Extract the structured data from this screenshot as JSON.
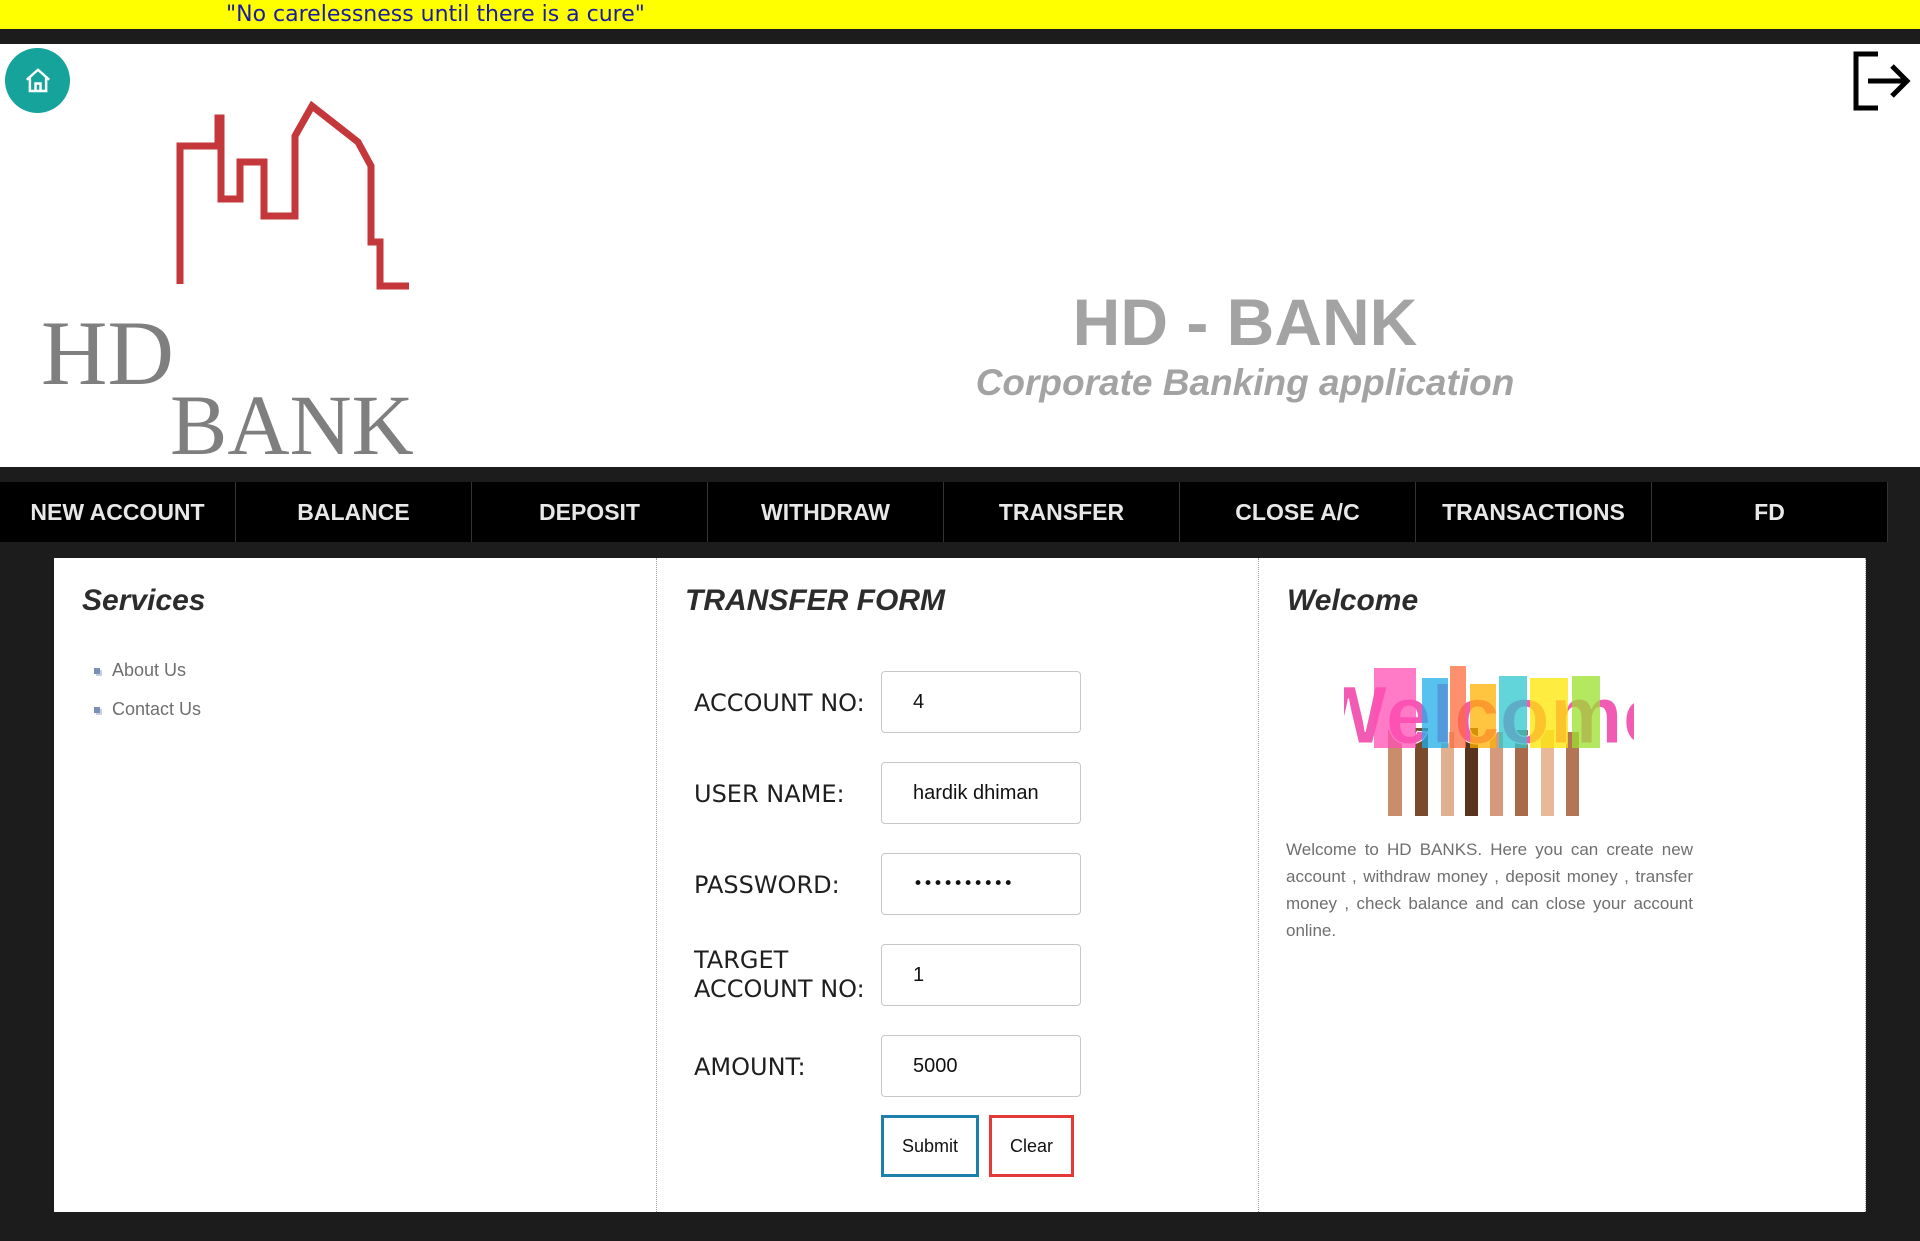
{
  "marquee": {
    "text": "\"No carelessness until there is a cure\""
  },
  "header": {
    "home_icon": "home-icon",
    "logout_icon": "logout-icon",
    "logo_text_line1": "HD",
    "logo_text_line2": "BANK",
    "title": "HD - BANK",
    "subtitle": "Corporate Banking application"
  },
  "nav": {
    "items": [
      {
        "label": "NEW ACCOUNT"
      },
      {
        "label": "BALANCE"
      },
      {
        "label": "DEPOSIT"
      },
      {
        "label": "WITHDRAW"
      },
      {
        "label": "TRANSFER"
      },
      {
        "label": "CLOSE A/C"
      },
      {
        "label": "TRANSACTIONS"
      },
      {
        "label": "FD"
      }
    ]
  },
  "services": {
    "title": "Services",
    "items": [
      {
        "label": "About Us"
      },
      {
        "label": "Contact Us"
      }
    ]
  },
  "transfer_form": {
    "title": "TRANSFER FORM",
    "account_no": {
      "label": "ACCOUNT NO:",
      "value": "4"
    },
    "user_name": {
      "label": "USER NAME:",
      "value": "hardik dhiman"
    },
    "password": {
      "label": "PASSWORD:",
      "value": "••••••••••"
    },
    "target_account_no": {
      "label_line1": "TARGET",
      "label_line2": "ACCOUNT NO:",
      "value": "1"
    },
    "amount": {
      "label": "AMOUNT:",
      "value": "5000"
    },
    "submit_label": "Submit",
    "clear_label": "Clear"
  },
  "welcome": {
    "title": "Welcome",
    "image_text": "Welcome",
    "description": "Welcome to HD BANKS. Here you can create new account , withdraw money , deposit money , transfer money , check balance and can close your account online."
  },
  "colors": {
    "marquee_bg": "#ffff00",
    "marquee_text": "#1a1aa6",
    "nav_bg": "#000000",
    "page_bg": "#1c1c1c",
    "home_button": "#16a39b",
    "logo_red": "#c4373a",
    "submit_border": "#1d7fab",
    "clear_border": "#e43a35"
  }
}
